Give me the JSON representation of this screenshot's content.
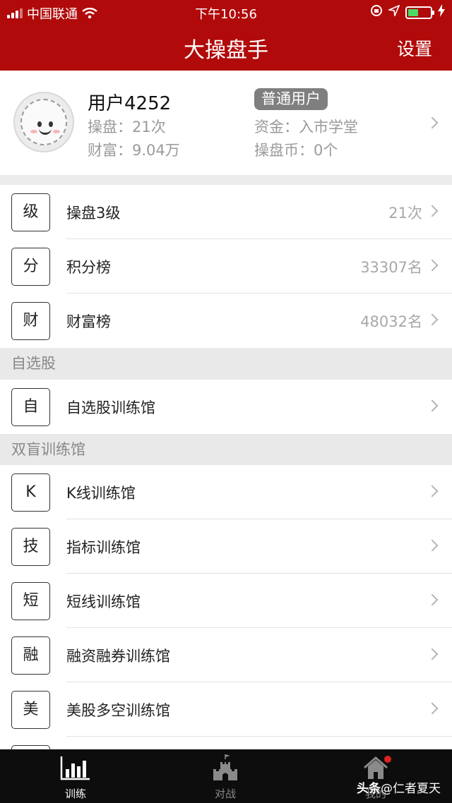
{
  "status_bar": {
    "carrier": "中国联通",
    "time": "下午10:56"
  },
  "header": {
    "title": "大操盘手",
    "settings_label": "设置"
  },
  "profile": {
    "username": "用户4252",
    "badge": "普通用户",
    "trades": "操盘：21次",
    "wealth": "财富：9.04万",
    "fund": "资金：入市学堂",
    "coins": "操盘币：0个"
  },
  "stats": [
    {
      "icon": "级",
      "label": "操盘3级",
      "value": "21次"
    },
    {
      "icon": "分",
      "label": "积分榜",
      "value": "33307名"
    },
    {
      "icon": "财",
      "label": "财富榜",
      "value": "48032名"
    }
  ],
  "sections": {
    "watchlist": "自选股",
    "blind": "双盲训练馆"
  },
  "watchlist_items": [
    {
      "icon": "自",
      "label": "自选股训练馆"
    }
  ],
  "blind_items": [
    {
      "icon": "K",
      "label": "K线训练馆"
    },
    {
      "icon": "技",
      "label": "指标训练馆"
    },
    {
      "icon": "短",
      "label": "短线训练馆"
    },
    {
      "icon": "融",
      "label": "融资融券训练馆"
    },
    {
      "icon": "美",
      "label": "美股多空训练馆"
    }
  ],
  "tabbar": {
    "tabs": [
      {
        "label": "训练",
        "icon": "bar-chart-icon",
        "active": true
      },
      {
        "label": "对战",
        "icon": "castle-icon",
        "active": false
      },
      {
        "label": "我的",
        "icon": "home-icon",
        "active": false
      }
    ]
  },
  "watermark": {
    "brand": "头条",
    "handle": "@仁者夏天"
  },
  "colors": {
    "header_red": "#b10a0a",
    "tab_active": "#ffffff",
    "tab_inactive": "#8a8a8a",
    "badge_gray": "#7f7f7f",
    "notification_dot": "#e02020"
  }
}
